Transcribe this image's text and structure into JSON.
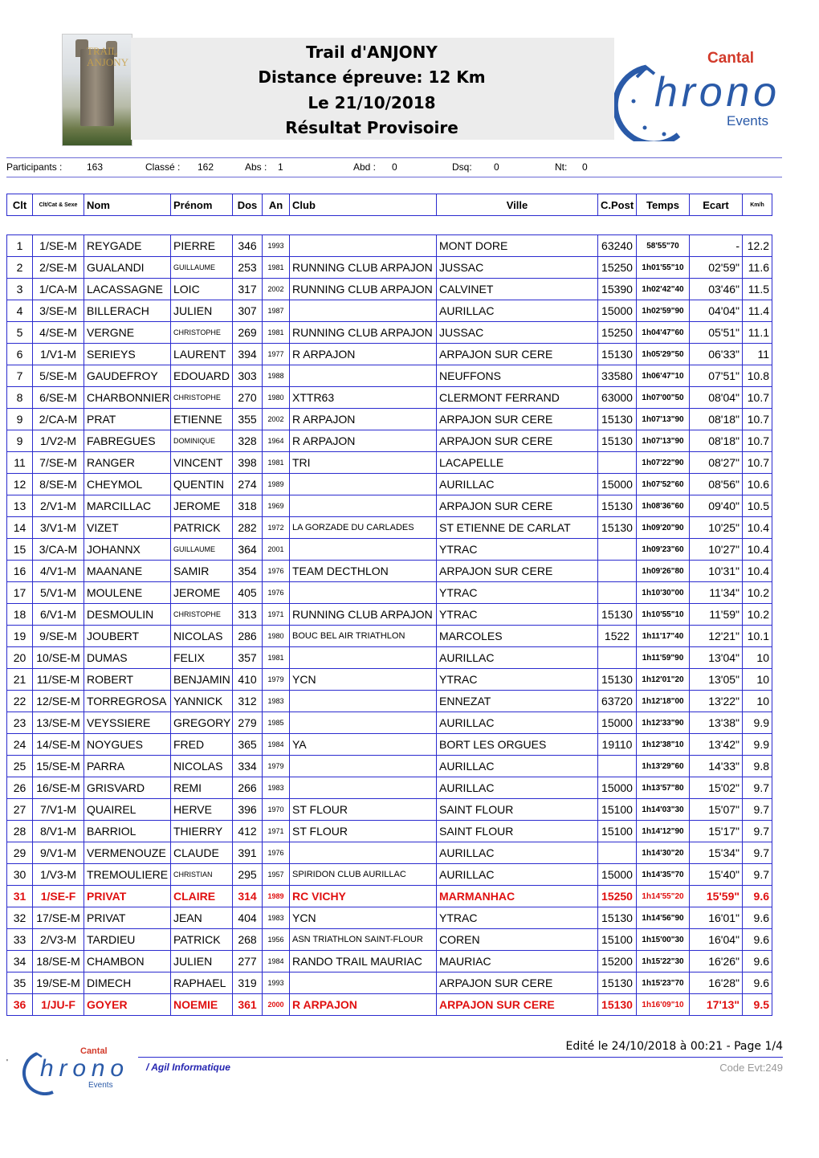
{
  "header": {
    "line1": "Trail d'ANJONY",
    "line2": "Distance épreuve: 12 Km",
    "line3": "Le 21/10/2018",
    "line4": "Résultat Provisoire",
    "photo_letters": "TRAIL ANJONY",
    "logo_top": "Cantal",
    "logo_main": "hrono",
    "logo_sub": "Events"
  },
  "summary": {
    "participants_label": "Participants :",
    "participants": "163",
    "classe_label": "Classé :",
    "classe": "162",
    "abs_label": "Abs :",
    "abs": "1",
    "abd_label": "Abd :",
    "abd": "0",
    "dsq_label": "Dsq:",
    "dsq": "0",
    "nt_label": "Nt:",
    "nt": "0"
  },
  "columns": {
    "clt": "Clt",
    "cat": "Clt/Cat & Sexe",
    "nom": "Nom",
    "prenom": "Prénom",
    "dos": "Dos",
    "an": "An",
    "club": "Club",
    "ville": "Ville",
    "cpost": "C.Post",
    "temps": "Temps",
    "ecart": "Ecart",
    "kmh": "Km/h"
  },
  "rows": [
    {
      "clt": "1",
      "cat": "1/SE-M",
      "nom": "REYGADE",
      "prenom": "PIERRE",
      "dos": "346",
      "an": "1993",
      "club": "",
      "ville": "MONT DORE",
      "cp": "63240",
      "temps": "58'55\"70",
      "ecart": "-",
      "kmh": "12.2"
    },
    {
      "clt": "2",
      "cat": "2/SE-M",
      "nom": "GUALANDI",
      "prenom": "GUILLAUME",
      "dos": "253",
      "an": "1981",
      "club": "RUNNING CLUB ARPAJON",
      "ville": "JUSSAC",
      "cp": "15250",
      "temps": "1h01'55\"10",
      "ecart": "02'59\"",
      "kmh": "11.6"
    },
    {
      "clt": "3",
      "cat": "1/CA-M",
      "nom": "LACASSAGNE",
      "prenom": "LOIC",
      "dos": "317",
      "an": "2002",
      "club": "RUNNING CLUB ARPAJON",
      "ville": "CALVINET",
      "cp": "15390",
      "temps": "1h02'42\"40",
      "ecart": "03'46\"",
      "kmh": "11.5"
    },
    {
      "clt": "4",
      "cat": "3/SE-M",
      "nom": "BILLERACH",
      "prenom": "JULIEN",
      "dos": "307",
      "an": "1987",
      "club": "",
      "ville": "AURILLAC",
      "cp": "15000",
      "temps": "1h02'59\"90",
      "ecart": "04'04\"",
      "kmh": "11.4"
    },
    {
      "clt": "5",
      "cat": "4/SE-M",
      "nom": "VERGNE",
      "prenom": "CHRISTOPHE",
      "dos": "269",
      "an": "1981",
      "club": "RUNNING CLUB ARPAJON",
      "ville": "JUSSAC",
      "cp": "15250",
      "temps": "1h04'47\"60",
      "ecart": "05'51\"",
      "kmh": "11.1"
    },
    {
      "clt": "6",
      "cat": "1/V1-M",
      "nom": "SERIEYS",
      "prenom": "LAURENT",
      "dos": "394",
      "an": "1977",
      "club": "R ARPAJON",
      "ville": "ARPAJON SUR CERE",
      "cp": "15130",
      "temps": "1h05'29\"50",
      "ecart": "06'33\"",
      "kmh": "11"
    },
    {
      "clt": "7",
      "cat": "5/SE-M",
      "nom": "GAUDEFROY",
      "prenom": "EDOUARD",
      "dos": "303",
      "an": "1988",
      "club": "",
      "ville": "NEUFFONS",
      "cp": "33580",
      "temps": "1h06'47\"10",
      "ecart": "07'51\"",
      "kmh": "10.8"
    },
    {
      "clt": "8",
      "cat": "6/SE-M",
      "nom": "CHARBONNIER",
      "prenom": "CHRISTOPHE",
      "dos": "270",
      "an": "1980",
      "club": "XTTR63",
      "ville": "CLERMONT FERRAND",
      "cp": "63000",
      "temps": "1h07'00\"50",
      "ecart": "08'04\"",
      "kmh": "10.7"
    },
    {
      "clt": "9",
      "cat": "2/CA-M",
      "nom": "PRAT",
      "prenom": "ETIENNE",
      "dos": "355",
      "an": "2002",
      "club": "R ARPAJON",
      "ville": "ARPAJON SUR CERE",
      "cp": "15130",
      "temps": "1h07'13\"90",
      "ecart": "08'18\"",
      "kmh": "10.7"
    },
    {
      "clt": "9",
      "cat": "1/V2-M",
      "nom": "FABREGUES",
      "prenom": "DOMINIQUE",
      "dos": "328",
      "an": "1964",
      "club": "R ARPAJON",
      "ville": "ARPAJON SUR CERE",
      "cp": "15130",
      "temps": "1h07'13\"90",
      "ecart": "08'18\"",
      "kmh": "10.7"
    },
    {
      "clt": "11",
      "cat": "7/SE-M",
      "nom": "RANGER",
      "prenom": "VINCENT",
      "dos": "398",
      "an": "1981",
      "club": "TRI",
      "ville": "LACAPELLE",
      "cp": "",
      "temps": "1h07'22\"90",
      "ecart": "08'27\"",
      "kmh": "10.7"
    },
    {
      "clt": "12",
      "cat": "8/SE-M",
      "nom": "CHEYMOL",
      "prenom": "QUENTIN",
      "dos": "274",
      "an": "1989",
      "club": "",
      "ville": "AURILLAC",
      "cp": "15000",
      "temps": "1h07'52\"60",
      "ecart": "08'56\"",
      "kmh": "10.6"
    },
    {
      "clt": "13",
      "cat": "2/V1-M",
      "nom": "MARCILLAC",
      "prenom": "JEROME",
      "dos": "318",
      "an": "1969",
      "club": "",
      "ville": "ARPAJON SUR CERE",
      "cp": "15130",
      "temps": "1h08'36\"60",
      "ecart": "09'40\"",
      "kmh": "10.5"
    },
    {
      "clt": "14",
      "cat": "3/V1-M",
      "nom": "VIZET",
      "prenom": "PATRICK",
      "dos": "282",
      "an": "1972",
      "club": "LA GORZADE DU CARLADES",
      "ville": "ST ETIENNE DE CARLAT",
      "cp": "15130",
      "temps": "1h09'20\"90",
      "ecart": "10'25\"",
      "kmh": "10.4"
    },
    {
      "clt": "15",
      "cat": "3/CA-M",
      "nom": "JOHANNX",
      "prenom": "GUILLAUME",
      "dos": "364",
      "an": "2001",
      "club": "",
      "ville": "YTRAC",
      "cp": "",
      "temps": "1h09'23\"60",
      "ecart": "10'27\"",
      "kmh": "10.4"
    },
    {
      "clt": "16",
      "cat": "4/V1-M",
      "nom": "MAANANE",
      "prenom": "SAMIR",
      "dos": "354",
      "an": "1976",
      "club": "TEAM DECTHLON",
      "ville": "ARPAJON SUR CERE",
      "cp": "",
      "temps": "1h09'26\"80",
      "ecart": "10'31\"",
      "kmh": "10.4"
    },
    {
      "clt": "17",
      "cat": "5/V1-M",
      "nom": "MOULENE",
      "prenom": "JEROME",
      "dos": "405",
      "an": "1976",
      "club": "",
      "ville": "YTRAC",
      "cp": "",
      "temps": "1h10'30\"00",
      "ecart": "11'34\"",
      "kmh": "10.2"
    },
    {
      "clt": "18",
      "cat": "6/V1-M",
      "nom": "DESMOULIN",
      "prenom": "CHRISTOPHE",
      "dos": "313",
      "an": "1971",
      "club": "RUNNING CLUB ARPAJON",
      "ville": "YTRAC",
      "cp": "15130",
      "temps": "1h10'55\"10",
      "ecart": "11'59\"",
      "kmh": "10.2"
    },
    {
      "clt": "19",
      "cat": "9/SE-M",
      "nom": "JOUBERT",
      "prenom": "NICOLAS",
      "dos": "286",
      "an": "1980",
      "club": "BOUC BEL AIR TRIATHLON",
      "ville": "MARCOLES",
      "cp": "1522",
      "temps": "1h11'17\"40",
      "ecart": "12'21\"",
      "kmh": "10.1"
    },
    {
      "clt": "20",
      "cat": "10/SE-M",
      "nom": "DUMAS",
      "prenom": "FELIX",
      "dos": "357",
      "an": "1981",
      "club": "",
      "ville": "AURILLAC",
      "cp": "",
      "temps": "1h11'59\"90",
      "ecart": "13'04\"",
      "kmh": "10"
    },
    {
      "clt": "21",
      "cat": "11/SE-M",
      "nom": "ROBERT",
      "prenom": "BENJAMIN",
      "dos": "410",
      "an": "1979",
      "club": "YCN",
      "ville": "YTRAC",
      "cp": "15130",
      "temps": "1h12'01\"20",
      "ecart": "13'05\"",
      "kmh": "10"
    },
    {
      "clt": "22",
      "cat": "12/SE-M",
      "nom": "TORREGROSA",
      "prenom": "YANNICK",
      "dos": "312",
      "an": "1983",
      "club": "",
      "ville": "ENNEZAT",
      "cp": "63720",
      "temps": "1h12'18\"00",
      "ecart": "13'22\"",
      "kmh": "10"
    },
    {
      "clt": "23",
      "cat": "13/SE-M",
      "nom": "VEYSSIERE",
      "prenom": "GREGORY",
      "dos": "279",
      "an": "1985",
      "club": "",
      "ville": "AURILLAC",
      "cp": "15000",
      "temps": "1h12'33\"90",
      "ecart": "13'38\"",
      "kmh": "9.9"
    },
    {
      "clt": "24",
      "cat": "14/SE-M",
      "nom": "NOYGUES",
      "prenom": "FRED",
      "dos": "365",
      "an": "1984",
      "club": "YA",
      "ville": "BORT LES ORGUES",
      "cp": "19110",
      "temps": "1h12'38\"10",
      "ecart": "13'42\"",
      "kmh": "9.9"
    },
    {
      "clt": "25",
      "cat": "15/SE-M",
      "nom": "PARRA",
      "prenom": "NICOLAS",
      "dos": "334",
      "an": "1979",
      "club": "",
      "ville": "AURILLAC",
      "cp": "",
      "temps": "1h13'29\"60",
      "ecart": "14'33\"",
      "kmh": "9.8"
    },
    {
      "clt": "26",
      "cat": "16/SE-M",
      "nom": "GRISVARD",
      "prenom": "REMI",
      "dos": "266",
      "an": "1983",
      "club": "",
      "ville": "AURILLAC",
      "cp": "15000",
      "temps": "1h13'57\"80",
      "ecart": "15'02\"",
      "kmh": "9.7"
    },
    {
      "clt": "27",
      "cat": "7/V1-M",
      "nom": "QUAIREL",
      "prenom": "HERVE",
      "dos": "396",
      "an": "1970",
      "club": "ST FLOUR",
      "ville": "SAINT FLOUR",
      "cp": "15100",
      "temps": "1h14'03\"30",
      "ecart": "15'07\"",
      "kmh": "9.7"
    },
    {
      "clt": "28",
      "cat": "8/V1-M",
      "nom": "BARRIOL",
      "prenom": "THIERRY",
      "dos": "412",
      "an": "1971",
      "club": "ST FLOUR",
      "ville": "SAINT FLOUR",
      "cp": "15100",
      "temps": "1h14'12\"90",
      "ecart": "15'17\"",
      "kmh": "9.7"
    },
    {
      "clt": "29",
      "cat": "9/V1-M",
      "nom": "VERMENOUZE",
      "prenom": "CLAUDE",
      "dos": "391",
      "an": "1976",
      "club": "",
      "ville": "AURILLAC",
      "cp": "",
      "temps": "1h14'30\"20",
      "ecart": "15'34\"",
      "kmh": "9.7"
    },
    {
      "clt": "30",
      "cat": "1/V3-M",
      "nom": "TREMOULIERE",
      "prenom": "CHRISTIAN",
      "dos": "295",
      "an": "1957",
      "club": "SPIRIDON CLUB AURILLAC",
      "ville": "AURILLAC",
      "cp": "15000",
      "temps": "1h14'35\"70",
      "ecart": "15'40\"",
      "kmh": "9.7"
    },
    {
      "clt": "31",
      "cat": "1/SE-F",
      "nom": "PRIVAT",
      "prenom": "CLAIRE",
      "dos": "314",
      "an": "1989",
      "club": "RC VICHY",
      "ville": "MARMANHAC",
      "cp": "15250",
      "temps": "1h14'55\"20",
      "ecart": "15'59\"",
      "kmh": "9.6",
      "hl": true
    },
    {
      "clt": "32",
      "cat": "17/SE-M",
      "nom": "PRIVAT",
      "prenom": "JEAN",
      "dos": "404",
      "an": "1983",
      "club": "YCN",
      "ville": "YTRAC",
      "cp": "15130",
      "temps": "1h14'56\"90",
      "ecart": "16'01\"",
      "kmh": "9.6"
    },
    {
      "clt": "33",
      "cat": "2/V3-M",
      "nom": "TARDIEU",
      "prenom": "PATRICK",
      "dos": "268",
      "an": "1956",
      "club": "ASN TRIATHLON SAINT-FLOUR",
      "ville": "COREN",
      "cp": "15100",
      "temps": "1h15'00\"30",
      "ecart": "16'04\"",
      "kmh": "9.6"
    },
    {
      "clt": "34",
      "cat": "18/SE-M",
      "nom": "CHAMBON",
      "prenom": "JULIEN",
      "dos": "277",
      "an": "1984",
      "club": "RANDO TRAIL MAURIAC",
      "ville": "MAURIAC",
      "cp": "15200",
      "temps": "1h15'22\"30",
      "ecart": "16'26\"",
      "kmh": "9.6"
    },
    {
      "clt": "35",
      "cat": "19/SE-M",
      "nom": "DIMECH",
      "prenom": "RAPHAEL",
      "dos": "319",
      "an": "1993",
      "club": "",
      "ville": "ARPAJON SUR CERE",
      "cp": "15130",
      "temps": "1h15'23\"70",
      "ecart": "16'28\"",
      "kmh": "9.6"
    },
    {
      "clt": "36",
      "cat": "1/JU-F",
      "nom": "GOYER",
      "prenom": "NOEMIE",
      "dos": "361",
      "an": "2000",
      "club": "R ARPAJON",
      "ville": "ARPAJON SUR CERE",
      "cp": "15130",
      "temps": "1h16'09\"10",
      "ecart": "17'13\"",
      "kmh": "9.5",
      "hl": true
    }
  ],
  "footer": {
    "edited": "Edité le 24/10/2018 à 00:21 - Page 1/4",
    "agil": "/ Agil Informatique",
    "code": "Code Evt:249",
    "bullet": "'"
  },
  "colors": {
    "grid": "#2b2bcf",
    "highlight": "#e01010",
    "logo_blue": "#2a5aa8",
    "logo_red": "#d23a2a"
  }
}
